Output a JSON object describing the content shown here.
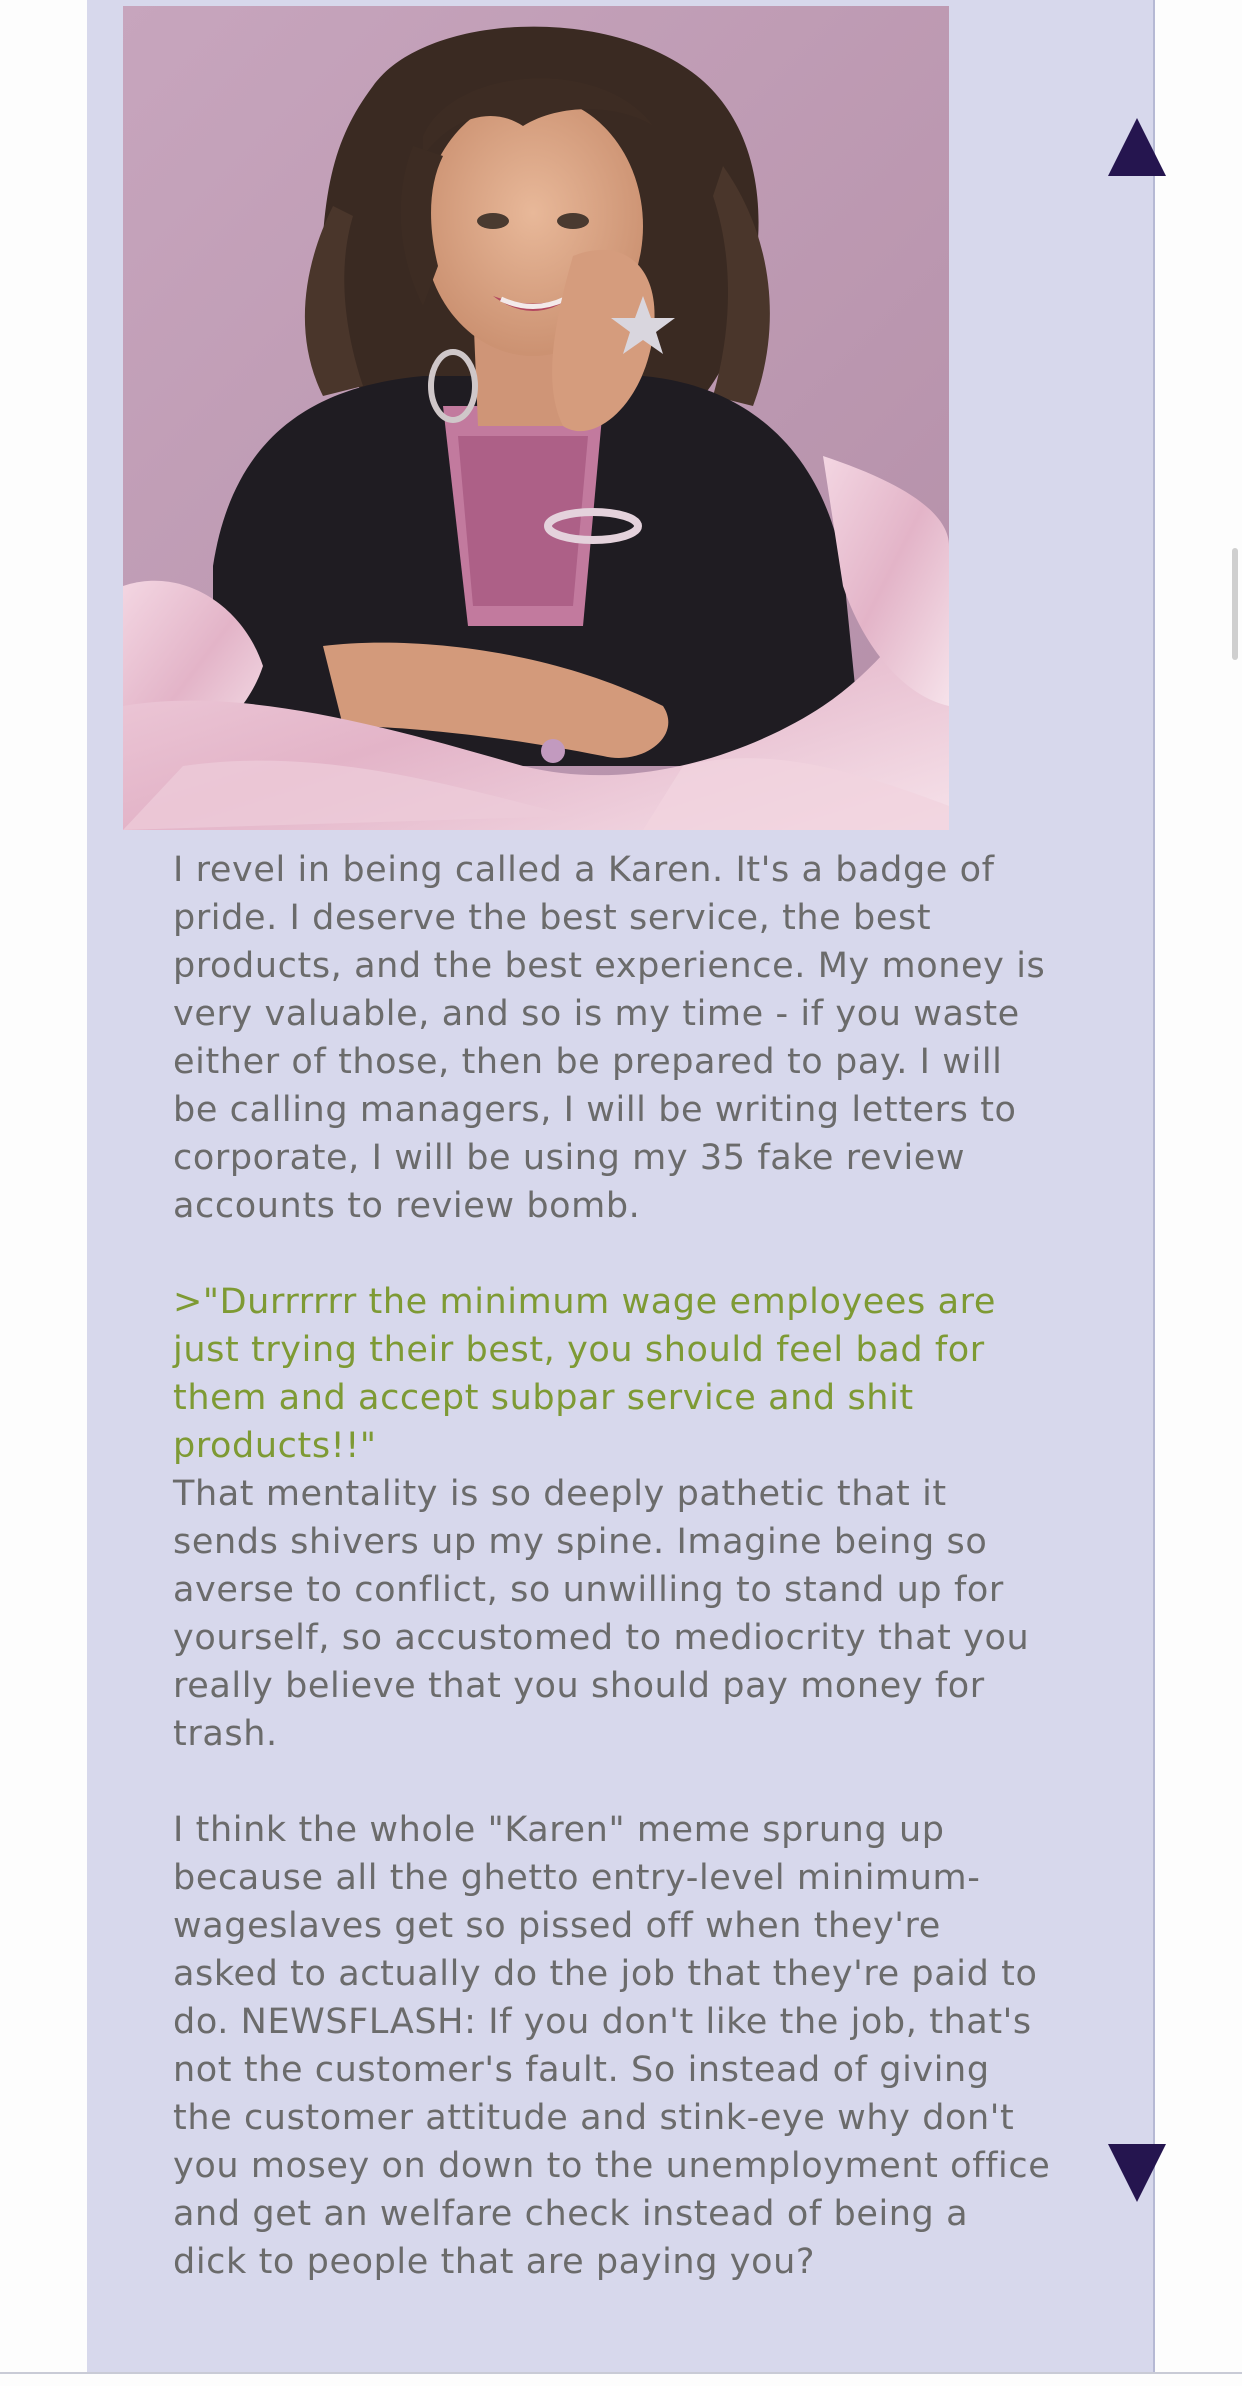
{
  "post": {
    "paragraph1": "I revel in being called a Karen. It's a badge of pride. I deserve the best service, the best products, and the best experience. My money is very valuable, and so is my time - if you waste either of those, then be prepared to pay. I will be calling managers, I will be writing letters to corporate, I will be using my 35 fake review accounts to review bomb.",
    "greentext": ">\"Durrrrrr the minimum wage employees are just trying their best, you should feel bad for them and accept subpar service and shit products!!\"",
    "paragraph2": "That mentality is so deeply pathetic that it sends shivers up my spine. Imagine being so averse to conflict, so unwilling to stand up for yourself, so accustomed to mediocrity that you really believe that you should pay money for trash.",
    "paragraph3": "I think the whole \"Karen\" meme sprung up because all the ghetto entry-level minimum-wageslaves get so pissed off when they're asked to actually do the job that they're paid to do. NEWSFLASH: If you don't like the job, that's not the customer's fault. So instead of giving the customer attitude and stink-eye why don't you mosey on down to the unemployment office and get an welfare check instead of being a dick to people that are paying you?"
  },
  "navigation": {
    "up_icon": "triangle-up-icon",
    "down_icon": "triangle-down-icon"
  },
  "colors": {
    "post_background": "#d7d8ec",
    "body_text": "#6b6b6b",
    "greentext": "#7e9a34",
    "arrow": "#25154f"
  }
}
